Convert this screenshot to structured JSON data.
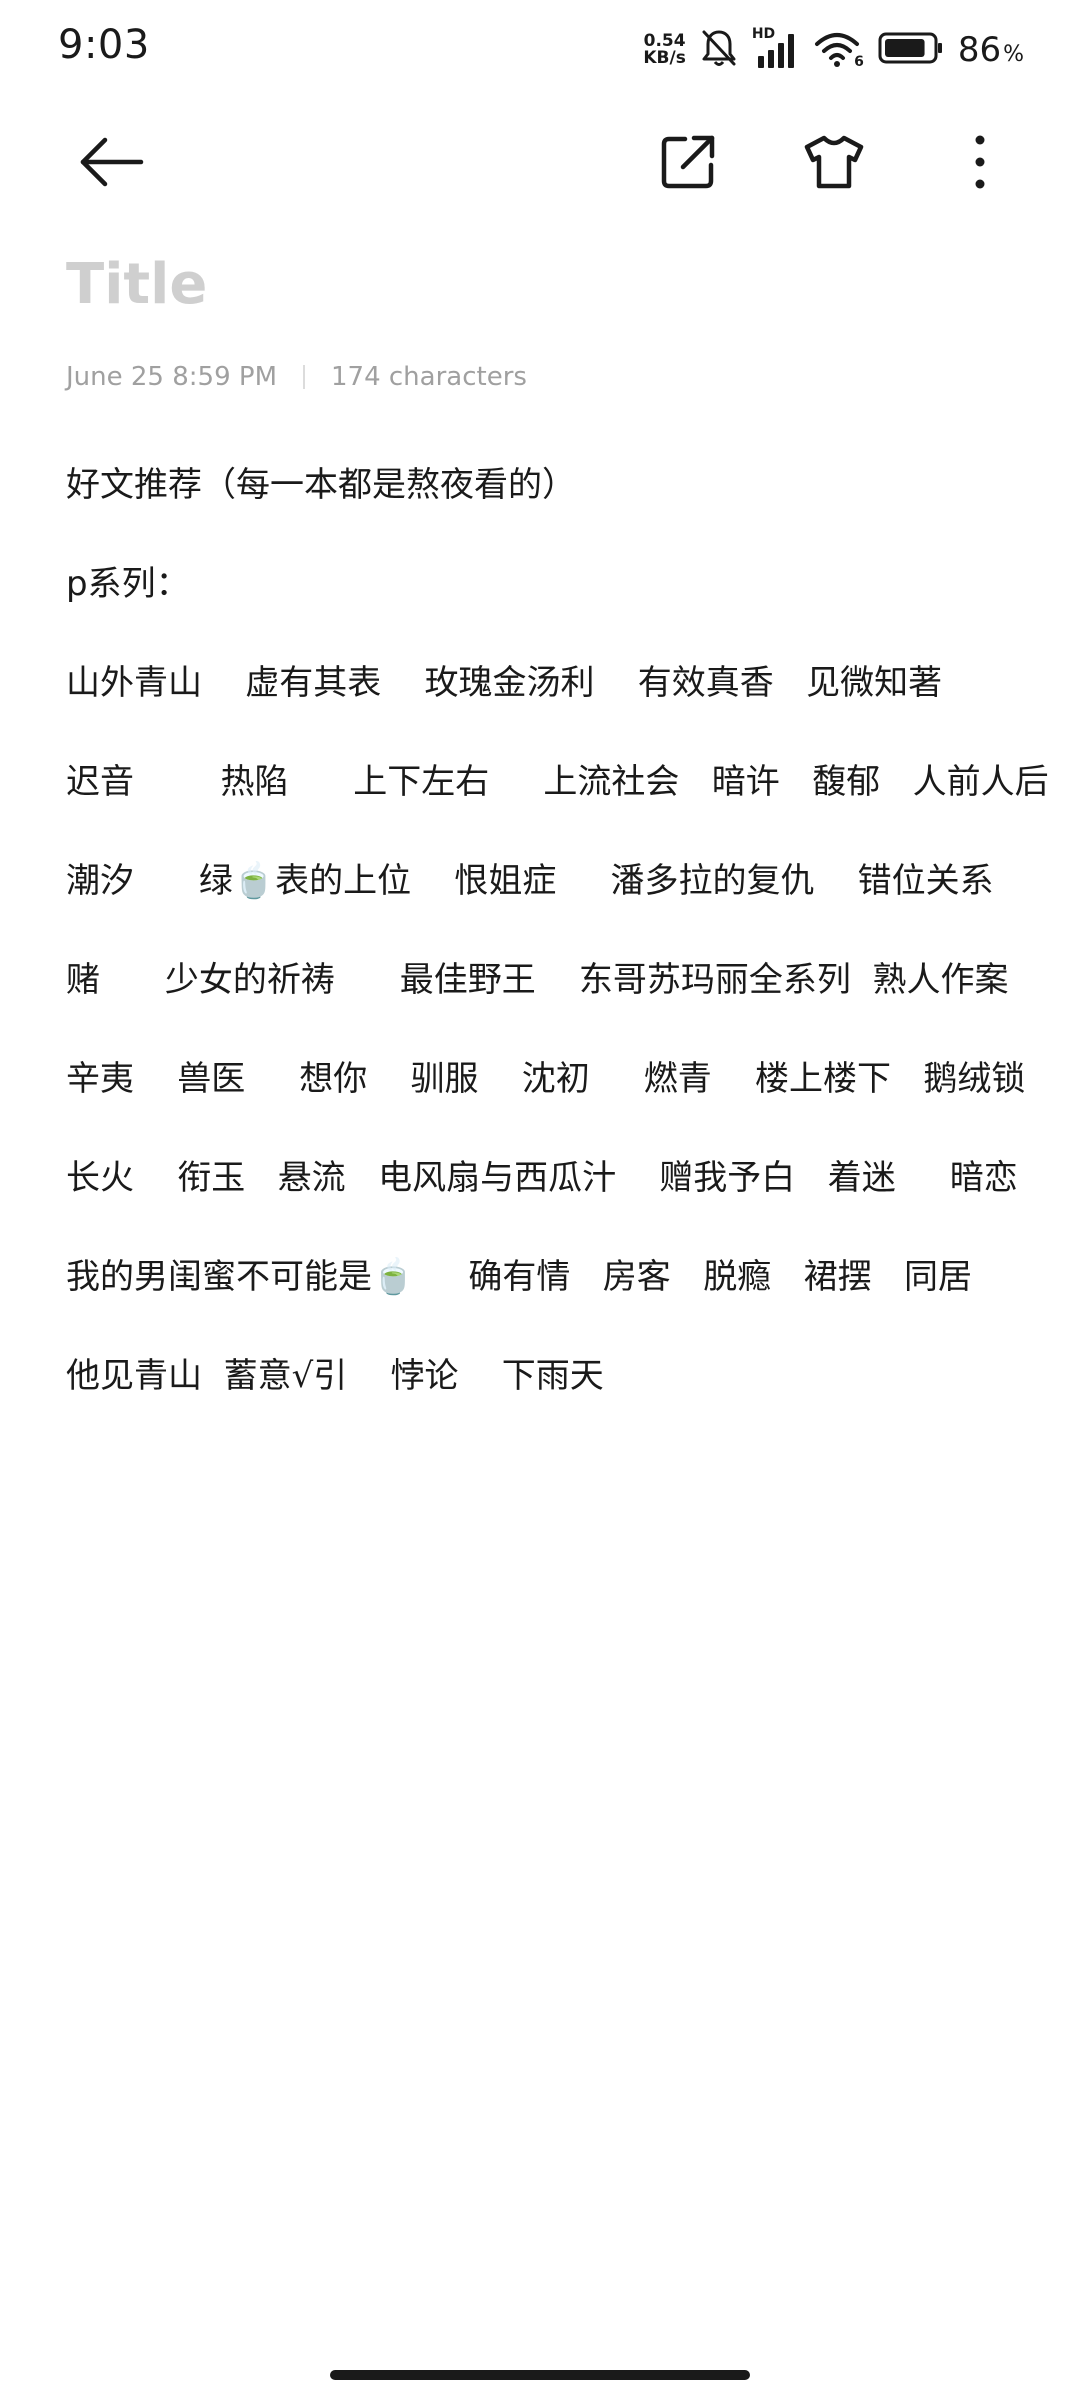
{
  "status_bar": {
    "time": "9:03",
    "net_speed_value": "0.54",
    "net_speed_unit": "KB/s",
    "signal_label": "HD",
    "wifi_label": "6",
    "battery_percent": "86",
    "battery_percent_sign": "%",
    "battery_level": 0.86
  },
  "toolbar": {
    "back_icon": "arrow-left-icon",
    "share_icon": "share-external-icon",
    "theme_icon": "tshirt-icon",
    "more_icon": "more-vertical-icon"
  },
  "note": {
    "title_placeholder": "Title",
    "date": "June 25 8:59 PM",
    "char_count": "174 characters",
    "lines": [
      "好文推荐（每一本都是熬夜看的）",
      "p系列：",
      "山外青山    虚有其表    玫瑰金汤利    有效真香   见微知著",
      "迟音        热陷      上下左右     上流社会   暗许   馥郁   人前人后",
      "潮汐      绿🍵表的上位    恨姐症     潘多拉的复仇    错位关系",
      "赌      少女的祈祷      最佳野王    东哥苏玛丽全系列  熟人作案",
      "辛夷    兽医     想你    驯服    沈初     燃青    楼上楼下   鹅绒锁",
      "长火    衔玉   悬流   电风扇与西瓜汁    赠我予白   着迷     暗恋",
      "我的男闺蜜不可能是🍵     确有情   房客   脱瘾   裙摆   同居",
      "他见青山  蓄意√引    悖论    下雨天"
    ]
  }
}
